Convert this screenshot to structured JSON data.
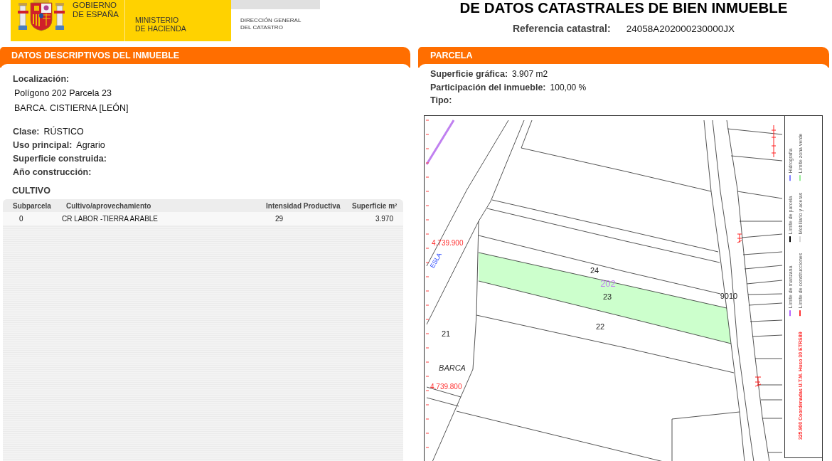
{
  "header": {
    "government": "GOBIERNO DE ESPAÑA",
    "ministry": "MINISTERIO DE HACIENDA",
    "directorate": "DIRECCIÓN GENERAL DEL CATASTRO"
  },
  "document": {
    "title": "DE DATOS CATASTRALES DE BIEN INMUEBLE",
    "reference": {
      "label": "Referencia catastral:",
      "value": "24058A202000230000JX"
    }
  },
  "property_panel": {
    "title": "DATOS DESCRIPTIVOS DEL INMUEBLE",
    "location": {
      "label": "Localización:",
      "lines": [
        "Polígono 202 Parcela 23",
        "BARCA. CISTIERNA [LEÓN]"
      ]
    },
    "fields": [
      {
        "label": "Clase:",
        "value": "RÚSTICO"
      },
      {
        "label": "Uso principal:",
        "value": "Agrario"
      },
      {
        "label": "Superficie construida:"
      },
      {
        "label": "Año construcción:"
      }
    ],
    "crops": {
      "title": "CULTIVO",
      "columns": [
        "Subparcela",
        "Cultivo/aprovechamiento",
        "Intensidad Productiva",
        "Superficie m²"
      ],
      "rows": [
        [
          "0",
          "CR LABOR -TIERRA ARABLE",
          "29",
          "3.970"
        ]
      ]
    }
  },
  "parcel_panel": {
    "title": "PARCELA",
    "fields": [
      {
        "label": "Superficie gráfica:",
        "value": "3.907 m2"
      },
      {
        "label": "Participación del inmueble:",
        "value": "100,00 %"
      },
      {
        "label": "Tipo:"
      }
    ],
    "map": {
      "labels": [
        {
          "text": "24",
          "kind": "parcel"
        },
        {
          "text": "202",
          "kind": "polygon"
        },
        {
          "text": "23",
          "kind": "parcel"
        },
        {
          "text": "22",
          "kind": "parcel"
        },
        {
          "text": "21",
          "kind": "parcel"
        },
        {
          "text": "BARCA",
          "kind": "place"
        },
        {
          "text": "9010",
          "kind": "parcel"
        },
        {
          "text": "4.739.900",
          "kind": "coordinate"
        },
        {
          "text": "4.739.800",
          "kind": "coordinate"
        },
        {
          "text": "ESLA",
          "kind": "river"
        }
      ],
      "legend": {
        "coordinates": "325.900 Coordenadas U.T.M. Huso 30 ETRS89",
        "items": [
          {
            "label": "Límite de manzana",
            "color": "#b366ff"
          },
          {
            "label": "Límite de parcela",
            "color": "#000000"
          },
          {
            "label": "Hidrografía",
            "color": "#8080ff"
          },
          {
            "label": "Límite de construcciones",
            "color": "#ff3333"
          },
          {
            "label": "Mobiliario y aceras",
            "color": "#d8d8d8"
          },
          {
            "label": "Límite zona verde",
            "color": "#99ee99"
          }
        ]
      }
    }
  }
}
